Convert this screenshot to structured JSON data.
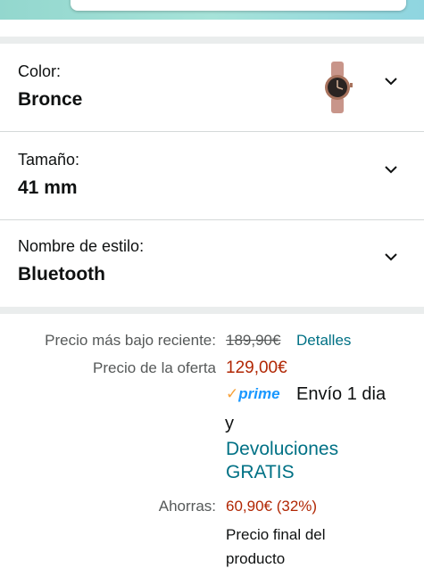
{
  "variations": {
    "color": {
      "label": "Color:",
      "value": "Bronce",
      "swatch_icon": "watch-thumbnail"
    },
    "size": {
      "label": "Tamaño:",
      "value": "41 mm"
    },
    "style": {
      "label": "Nombre de estilo:",
      "value": "Bluetooth"
    }
  },
  "pricing": {
    "lowest_label": "Precio más bajo reciente:",
    "lowest_value": "189,90€",
    "details_link": "Detalles",
    "deal_label": "Precio de la oferta",
    "deal_value": "129,00€",
    "prime_check": "✓",
    "prime_text": "prime",
    "shipping_text": "Envío 1 dia",
    "conjunction": "y",
    "returns_line1": "Devoluciones",
    "returns_line2": "GRATIS",
    "savings_label": "Ahorras:",
    "savings_value": "60,90€ (32%)",
    "final_line1": "Precio final del",
    "final_line2": "producto"
  },
  "colors": {
    "link": "#007185",
    "price": "#b12704",
    "prime": "#1a98ff"
  }
}
